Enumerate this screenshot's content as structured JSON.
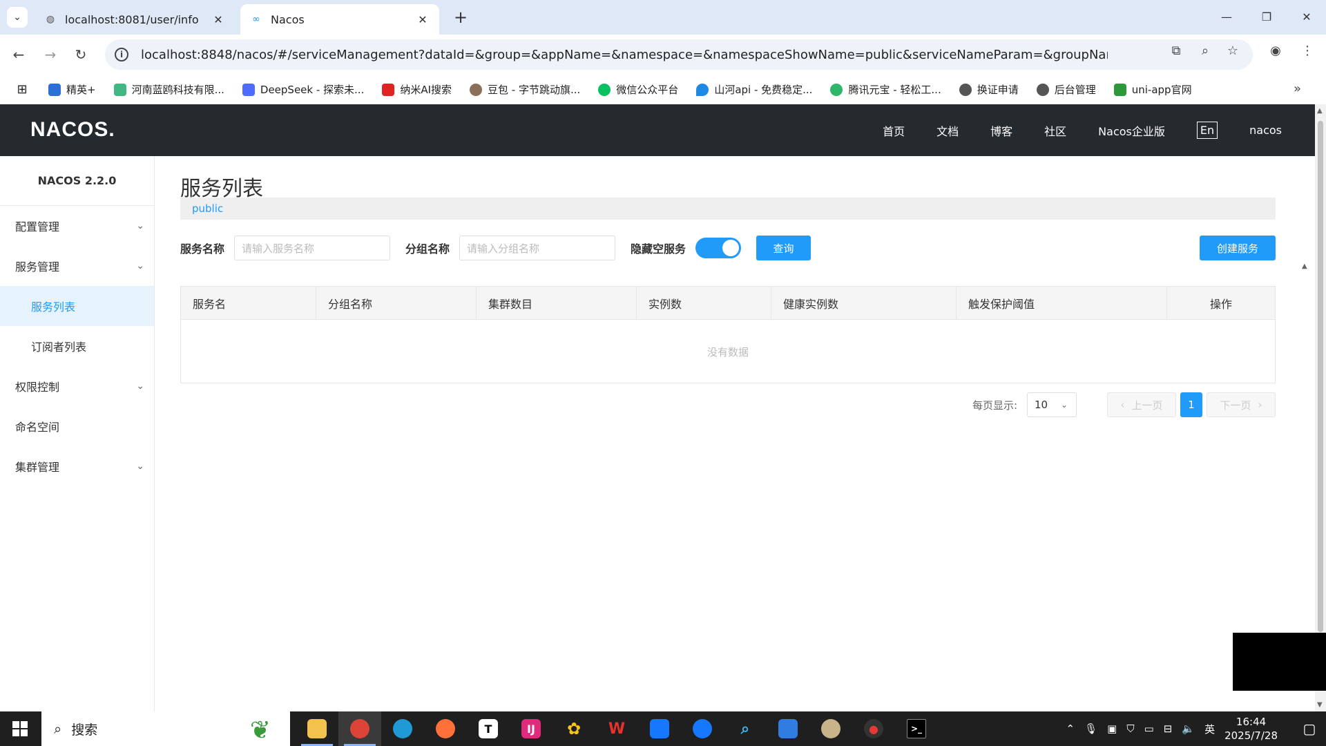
{
  "browser": {
    "tabs": [
      {
        "title": "localhost:8081/user/info",
        "active": false
      },
      {
        "title": "Nacos",
        "active": true
      }
    ],
    "url": "localhost:8848/nacos/#/serviceManagement?dataId=&group=&appName=&namespace=&namespaceShowName=public&serviceNameParam=&groupNameParam=",
    "bookmarks": [
      "精英+",
      "河南蓝鸥科技有限...",
      "DeepSeek - 探索未...",
      "纳米AI搜索",
      "豆包 - 字节跳动旗...",
      "微信公众平台",
      "山河api - 免费稳定...",
      "腾讯元宝 - 轻松工...",
      "换证申请",
      "后台管理",
      "uni-app官网"
    ]
  },
  "nacos": {
    "logo": "NACOS.",
    "topnav": [
      "首页",
      "文档",
      "博客",
      "社区",
      "Nacos企业版",
      "En",
      "nacos"
    ],
    "version": "NACOS 2.2.0",
    "menu": {
      "config": "配置管理",
      "service": "服务管理",
      "service_list": "服务列表",
      "subscriber_list": "订阅者列表",
      "auth": "权限控制",
      "namespace": "命名空间",
      "cluster": "集群管理"
    },
    "page_title": "服务列表",
    "namespace": "public",
    "filter": {
      "service_name_label": "服务名称",
      "service_name_placeholder": "请输入服务名称",
      "group_name_label": "分组名称",
      "group_name_placeholder": "请输入分组名称",
      "hide_empty_label": "隐藏空服务",
      "hide_empty_on": true,
      "query_button": "查询",
      "create_button": "创建服务"
    },
    "table": {
      "columns": [
        "服务名",
        "分组名称",
        "集群数目",
        "实例数",
        "健康实例数",
        "触发保护阈值",
        "操作"
      ],
      "empty_text": "没有数据"
    },
    "pager": {
      "per_page_label": "每页显示:",
      "per_page_value": "10",
      "prev": "上一页",
      "current": "1",
      "next": "下一页"
    }
  },
  "taskbar": {
    "search_text": "搜索",
    "ime": "英",
    "time": "16:44",
    "date": "2025/7/28"
  },
  "colors": {
    "accent": "#209bfa",
    "topbar": "#252a2f"
  }
}
